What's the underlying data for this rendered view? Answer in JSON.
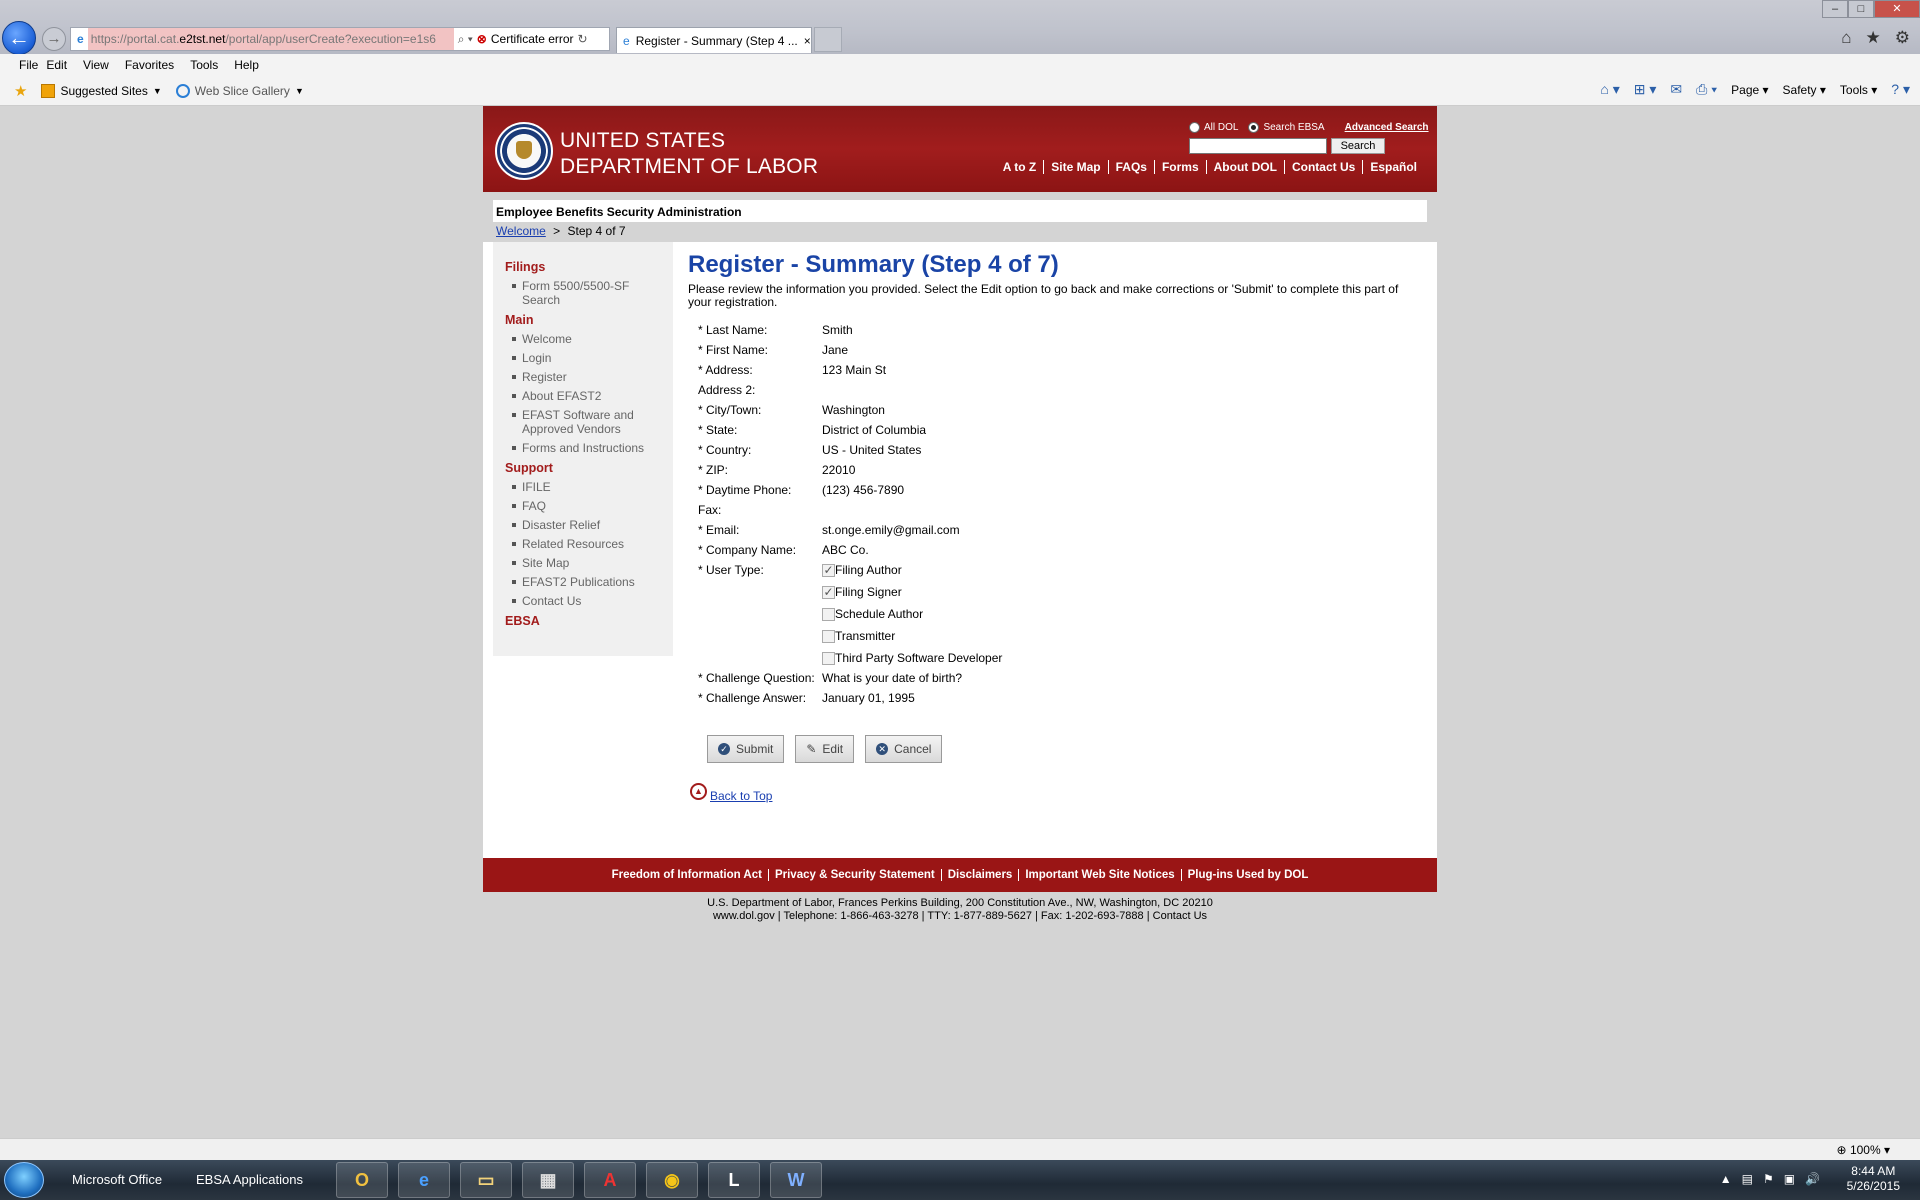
{
  "browser": {
    "url_prefix": "https://portal.cat.",
    "url_domain": "e2tst.net",
    "url_rest": "/portal/app/userCreate?execution=e1s6",
    "cert_error": "Certificate error",
    "tab_title": "Register - Summary (Step 4 ...",
    "menu": [
      "File",
      "Edit",
      "View",
      "Favorites",
      "Tools",
      "Help"
    ],
    "favorites": [
      "Suggested Sites",
      "Web Slice Gallery"
    ],
    "commands": [
      "Page",
      "Safety",
      "Tools"
    ]
  },
  "masthead": {
    "agency_line1": "UNITED STATES",
    "agency_line2": "DEPARTMENT OF LABOR",
    "search_all": "All DOL",
    "search_ebsa": "Search EBSA",
    "advanced_search": "Advanced Search",
    "search_button": "Search",
    "nav": [
      "A to Z",
      "Site Map",
      "FAQs",
      "Forms",
      "About DOL",
      "Contact Us",
      "Español"
    ]
  },
  "agency_bar": "Employee Benefits Security Administration",
  "breadcrumb": {
    "home": "Welcome",
    "sep": ">",
    "current": "Step 4 of 7"
  },
  "sidebar": {
    "filings_title": "Filings",
    "filings": [
      "Form 5500/5500-SF Search"
    ],
    "main_title": "Main",
    "main": [
      "Welcome",
      "Login",
      "Register",
      "About EFAST2",
      "EFAST Software and Approved Vendors",
      "Forms and Instructions"
    ],
    "support_title": "Support",
    "support": [
      "IFILE",
      "FAQ",
      "Disaster Relief",
      "Related Resources",
      "Site Map",
      "EFAST2 Publications",
      "Contact Us"
    ],
    "ebsa_title": "EBSA"
  },
  "main": {
    "title": "Register - Summary (Step 4 of 7)",
    "intro": "Please review the information you provided. Select the Edit option to go back and make corrections or 'Submit' to complete this part of your registration.",
    "fields": [
      {
        "label": "* Last Name:",
        "value": "Smith"
      },
      {
        "label": "* First Name:",
        "value": "Jane"
      },
      {
        "label": "* Address:",
        "value": "123 Main St"
      },
      {
        "label": "Address 2:",
        "value": ""
      },
      {
        "label": "* City/Town:",
        "value": "Washington"
      },
      {
        "label": "* State:",
        "value": "District of Columbia"
      },
      {
        "label": "* Country:",
        "value": "US - United States"
      },
      {
        "label": "* ZIP:",
        "value": "22010"
      },
      {
        "label": "* Daytime Phone:",
        "value": "(123) 456-7890"
      },
      {
        "label": "Fax:",
        "value": ""
      },
      {
        "label": "* Email:",
        "value": "st.onge.emily@gmail.com"
      },
      {
        "label": "* Company Name:",
        "value": "ABC Co."
      }
    ],
    "user_type_label": "* User Type:",
    "user_types": [
      {
        "label": "Filing Author",
        "checked": true
      },
      {
        "label": "Filing Signer",
        "checked": true
      },
      {
        "label": "Schedule Author",
        "checked": false
      },
      {
        "label": "Transmitter",
        "checked": false
      },
      {
        "label": "Third Party Software Developer",
        "checked": false
      }
    ],
    "challenge_question_label": "* Challenge Question:",
    "challenge_question": "What is your date of birth?",
    "challenge_answer_label": "* Challenge Answer:",
    "challenge_answer": "January 01, 1995",
    "submit": "Submit",
    "edit": "Edit",
    "cancel": "Cancel",
    "back_to_top": "Back to Top"
  },
  "footer": {
    "links": [
      "Freedom of Information Act",
      "Privacy & Security Statement",
      "Disclaimers",
      "Important Web Site Notices",
      "Plug-ins Used by DOL"
    ],
    "address_line1": "U.S. Department of Labor, Frances Perkins Building, 200 Constitution Ave., NW, Washington, DC 20210",
    "address_line2": "www.dol.gov | Telephone: 1-866-463-3278 | TTY: 1-877-889-5627 | Fax: 1-202-693-7888 | Contact Us"
  },
  "status": {
    "zoom": "100%"
  },
  "taskbar": {
    "items": [
      "Microsoft Office",
      "EBSA Applications"
    ],
    "time": "8:44 AM",
    "date": "5/26/2015"
  }
}
